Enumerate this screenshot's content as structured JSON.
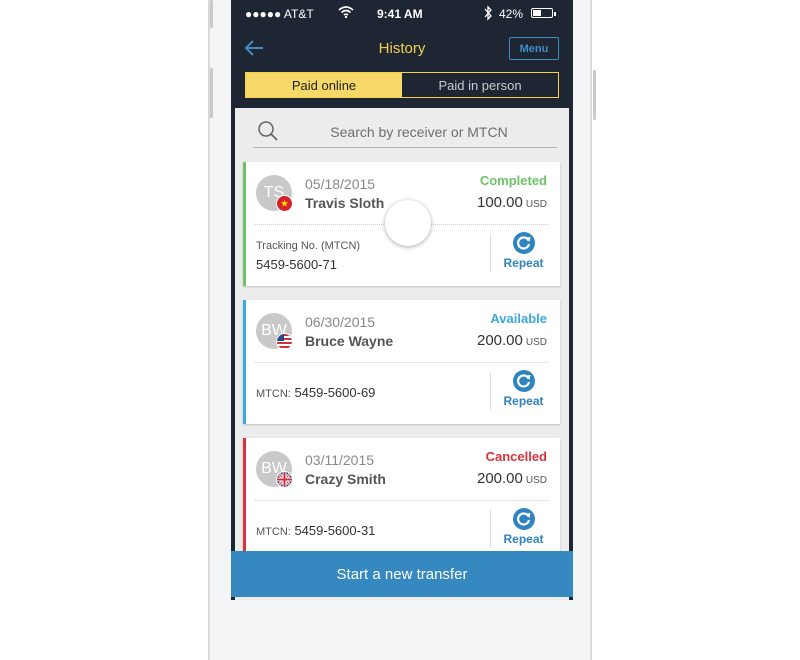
{
  "status_bar": {
    "carrier": "●●●●● AT&T",
    "time": "9:41 AM",
    "battery_percent_text": "42%",
    "battery_level": 0.42,
    "icons": [
      "signal-dots-icon",
      "wifi-icon",
      "bluetooth-icon",
      "battery-icon"
    ]
  },
  "navbar": {
    "back_icon": "arrow-left-icon",
    "title": "History",
    "menu_label": "Menu"
  },
  "segmented_control": {
    "options": [
      {
        "label": "Paid online",
        "active": true
      },
      {
        "label": "Paid in person",
        "active": false
      }
    ]
  },
  "search": {
    "icon": "search-icon",
    "placeholder": "Search by receiver or MTCN",
    "value": ""
  },
  "transactions": [
    {
      "initials": "TS",
      "flag": "vietnam",
      "date": "05/18/2015",
      "name": "Travis Sloth",
      "status": "Completed",
      "status_color": "#6cc36a",
      "amount": "100.00",
      "currency": "USD",
      "mtcn_label": "Tracking No. (MTCN)",
      "mtcn": "5459-5600-71",
      "repeat_label": "Repeat"
    },
    {
      "initials": "BW",
      "flag": "usa",
      "date": "06/30/2015",
      "name": "Bruce Wayne",
      "status": "Available",
      "status_color": "#3aa9dc",
      "amount": "200.00",
      "currency": "USD",
      "mtcn_label": "MTCN:",
      "mtcn": "5459-5600-69",
      "repeat_label": "Repeat"
    },
    {
      "initials": "BW",
      "flag": "uk",
      "date": "03/11/2015",
      "name": "Crazy Smith",
      "status": "Cancelled",
      "status_color": "#d8343f",
      "amount": "200.00",
      "currency": "USD",
      "mtcn_label": "MTCN:",
      "mtcn": "5459-5600-31",
      "repeat_label": "Repeat"
    }
  ],
  "cta": {
    "label": "Start a new transfer"
  },
  "colors": {
    "header_bg": "#1e2533",
    "accent_yellow": "#f5d04e",
    "accent_blue": "#3589c0"
  }
}
